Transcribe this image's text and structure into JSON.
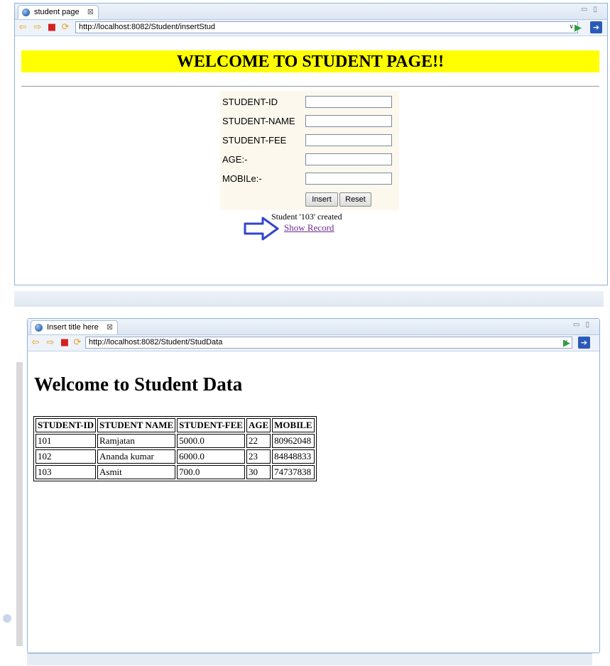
{
  "window1": {
    "tab_title": "student page",
    "tab_close": "⊠",
    "url": "http://localhost:8082/Student/insertStud",
    "banner": "WELCOME TO STUDENT PAGE!!",
    "form": {
      "fields": [
        {
          "label": "STUDENT-ID",
          "value": ""
        },
        {
          "label": "STUDENT-NAME",
          "value": ""
        },
        {
          "label": "STUDENT-FEE",
          "value": ""
        },
        {
          "label": "AGE:-",
          "value": ""
        },
        {
          "label": "MOBILe:-",
          "value": ""
        }
      ],
      "insert_label": "Insert",
      "reset_label": "Reset"
    },
    "message": "Student '103' created",
    "link": "Show Record",
    "arrow_color": "#3344cc"
  },
  "window2": {
    "tab_title": "Insert title here",
    "tab_close": "⊠",
    "url": "http://localhost:8082/Student/StudData",
    "heading": "Welcome to Student Data",
    "table": {
      "headers": [
        "STUDENT-ID",
        "STUDENT NAME",
        "STUDENT-FEE",
        "AGE",
        "MOBILE"
      ],
      "rows": [
        [
          "101",
          "Ramjatan",
          "5000.0",
          "22",
          "80962048"
        ],
        [
          "102",
          "Ananda kumar",
          "6000.0",
          "23",
          "84848833"
        ],
        [
          "103",
          "Asmit",
          "700.0",
          "30",
          "74737838"
        ]
      ]
    }
  },
  "colors": {
    "banner_bg": "#ffff00",
    "form_bg": "#fdf8ee",
    "link": "#6e2a8e",
    "frame": "#8fb3d9"
  }
}
